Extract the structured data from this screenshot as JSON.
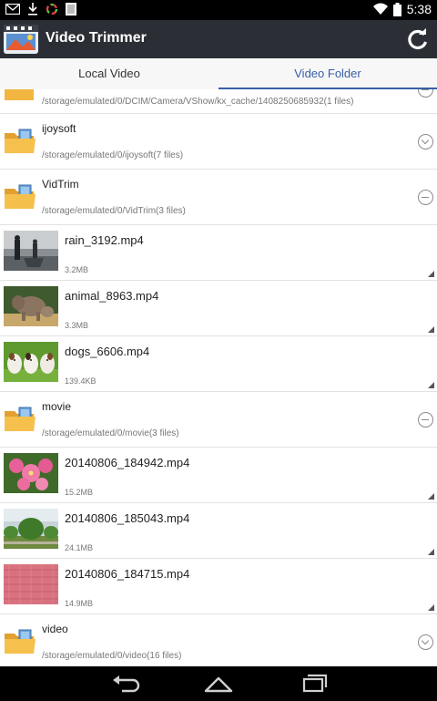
{
  "status_bar": {
    "time": "5:38",
    "icons": [
      "gmail-icon",
      "download-icon",
      "sync-icon",
      "photo-icon",
      "wifi-icon",
      "battery-icon"
    ]
  },
  "app": {
    "title": "Video Trimmer",
    "refresh_icon": "refresh-icon"
  },
  "tabs": [
    {
      "label": "Local Video",
      "active": false
    },
    {
      "label": "Video Folder",
      "active": true
    }
  ],
  "list": {
    "partial_folder": {
      "path": "/storage/emulated/0/DCIM/Camera/VShow/kx_cache/1408250685932(1 files)"
    },
    "rows": [
      {
        "kind": "folder",
        "name": "ijoysoft",
        "path": "/storage/emulated/0/ijoysoft(7 files)",
        "state": "collapsed"
      },
      {
        "kind": "folder",
        "name": "VidTrim",
        "path": "/storage/emulated/0/VidTrim(3 files)",
        "state": "expanded"
      },
      {
        "kind": "video",
        "name": "rain_3192.mp4",
        "size": "3.2MB",
        "thumb": "rain-thumbnail"
      },
      {
        "kind": "video",
        "name": "animal_8963.mp4",
        "size": "3.3MB",
        "thumb": "elephants-thumbnail"
      },
      {
        "kind": "video",
        "name": "dogs_6606.mp4",
        "size": "139.4KB",
        "thumb": "puppies-thumbnail"
      },
      {
        "kind": "folder",
        "name": "movie",
        "path": "/storage/emulated/0/movie(3 files)",
        "state": "expanded"
      },
      {
        "kind": "video",
        "name": "20140806_184942.mp4",
        "size": "15.2MB",
        "thumb": "flowers-thumbnail"
      },
      {
        "kind": "video",
        "name": "20140806_185043.mp4",
        "size": "24.1MB",
        "thumb": "garden-thumbnail"
      },
      {
        "kind": "video",
        "name": "20140806_184715.mp4",
        "size": "14.9MB",
        "thumb": "pink-wall-thumbnail"
      },
      {
        "kind": "folder",
        "name": "video",
        "path": "/storage/emulated/0/video(16 files)",
        "state": "collapsed"
      }
    ]
  },
  "nav_bar": {
    "buttons": [
      "back-icon",
      "home-icon",
      "recents-icon"
    ]
  },
  "colors": {
    "action_bar": "#2b2f35",
    "accent": "#3a5ea6",
    "folder": "#f2b640"
  }
}
